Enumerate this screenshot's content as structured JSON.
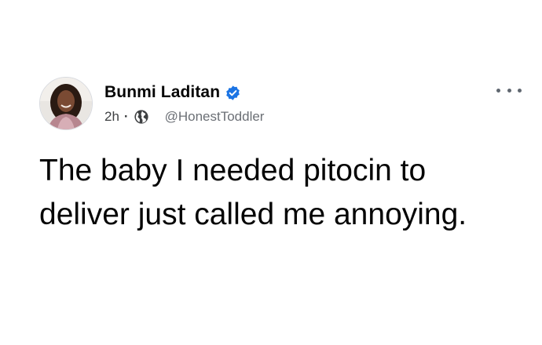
{
  "post": {
    "author": {
      "name": "Bunmi Laditan",
      "verified": true,
      "avatar_icon": "profile-photo"
    },
    "meta": {
      "time": "2h",
      "separator": "·",
      "audience_icon": "globe-icon",
      "handle": "@HonestToddler"
    },
    "text": "The baby I needed pitocin to deliver just called me annoying.",
    "more_icon": "ellipsis-icon"
  },
  "colors": {
    "verified_badge": "#1b74e4",
    "meta_text": "#65676b",
    "post_text": "#050505"
  }
}
